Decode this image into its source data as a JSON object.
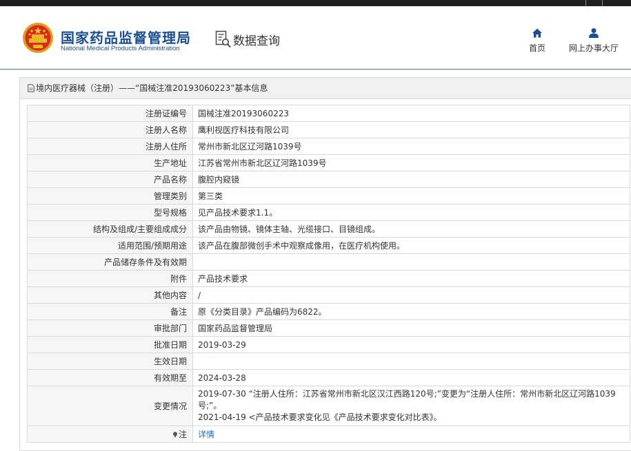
{
  "header": {
    "org_name_cn": "国家药品监督管理局",
    "org_name_en": "National Medical Products Administration",
    "query_label": "数据查询",
    "nav": [
      {
        "icon": "home-icon",
        "label": "首页"
      },
      {
        "icon": "user-icon",
        "label": "网上办事大厅"
      }
    ]
  },
  "panel": {
    "title": "境内医疗器械（注册）——“国械注准20193060223”基本信息"
  },
  "rows": [
    {
      "label": "注册证编号",
      "value": "国械注准20193060223"
    },
    {
      "label": "注册人名称",
      "value": "鹰利视医疗科技有限公司"
    },
    {
      "label": "注册人住所",
      "value": "常州市新北区辽河路1039号"
    },
    {
      "label": "生产地址",
      "value": "江苏省常州市新北区辽河路1039号"
    },
    {
      "label": "产品名称",
      "value": "腹腔内窥镜"
    },
    {
      "label": "管理类别",
      "value": "第三类"
    },
    {
      "label": "型号规格",
      "value": "见产品技术要求1.1。"
    },
    {
      "label": "结构及组成/主要组成成分",
      "value": "该产品由物镜、镜体主轴、光缆接口、目镜组成。"
    },
    {
      "label": "适用范围/预期用途",
      "value": "该产品在腹部微创手术中观察成像用，在医疗机构使用。"
    },
    {
      "label": "产品储存条件及有效期",
      "value": ""
    },
    {
      "label": "附件",
      "value": "产品技术要求"
    },
    {
      "label": "其他内容",
      "value": "/"
    },
    {
      "label": "备注",
      "value": "原《分类目录》产品编码为6822。"
    },
    {
      "label": "审批部门",
      "value": "国家药品监督管理局"
    },
    {
      "label": "批准日期",
      "value": "2019-03-29"
    },
    {
      "label": "生效日期",
      "value": ""
    },
    {
      "label": "有效期至",
      "value": "2024-03-28"
    }
  ],
  "change_row": {
    "label": "变更情况",
    "line1": "2019-07-30 “注册人住所：江苏省常州市新北区汉江西路120号;”变更为“注册人住所：常州市新北区辽河路1039号;”。",
    "line2": "2021-04-19 <产品技术要求变化见《产品技术要求变化对比表》。"
  },
  "note_row": {
    "label": "注",
    "link": "详情"
  }
}
